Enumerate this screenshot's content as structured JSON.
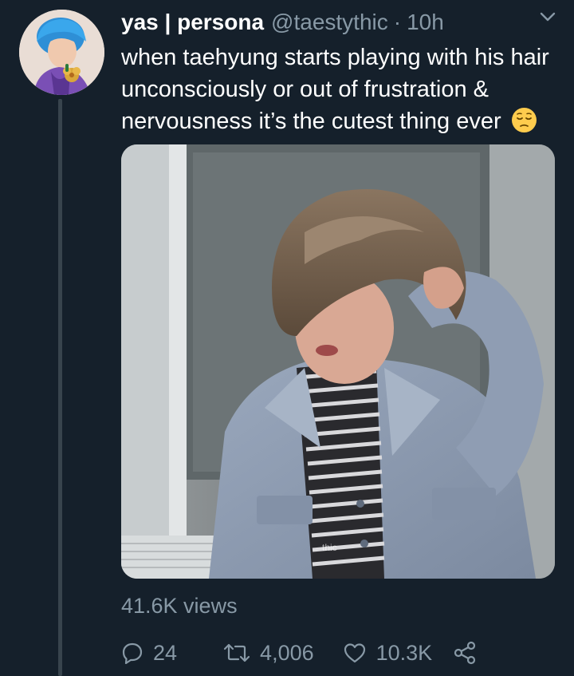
{
  "tweet": {
    "display_name": "yas | persona",
    "handle": "@taestythic",
    "separator": "·",
    "time": "10h",
    "text": "when taehyung starts playing with his hair unconsciously or out of frustration & nervousness it’s the cutest thing ever",
    "emoji": "pensive-face",
    "media_watermark": "thic",
    "views": "41.6K views"
  },
  "actions": {
    "replies": "24",
    "retweets": "4,006",
    "likes": "10.3K"
  },
  "colors": {
    "background": "#15202b",
    "text": "#ffffff",
    "secondary": "#8899a6",
    "thread_line": "#38444d"
  },
  "icons": {
    "caret": "chevron-down-icon",
    "reply": "reply-icon",
    "retweet": "retweet-icon",
    "like": "heart-icon",
    "share": "share-icon"
  }
}
